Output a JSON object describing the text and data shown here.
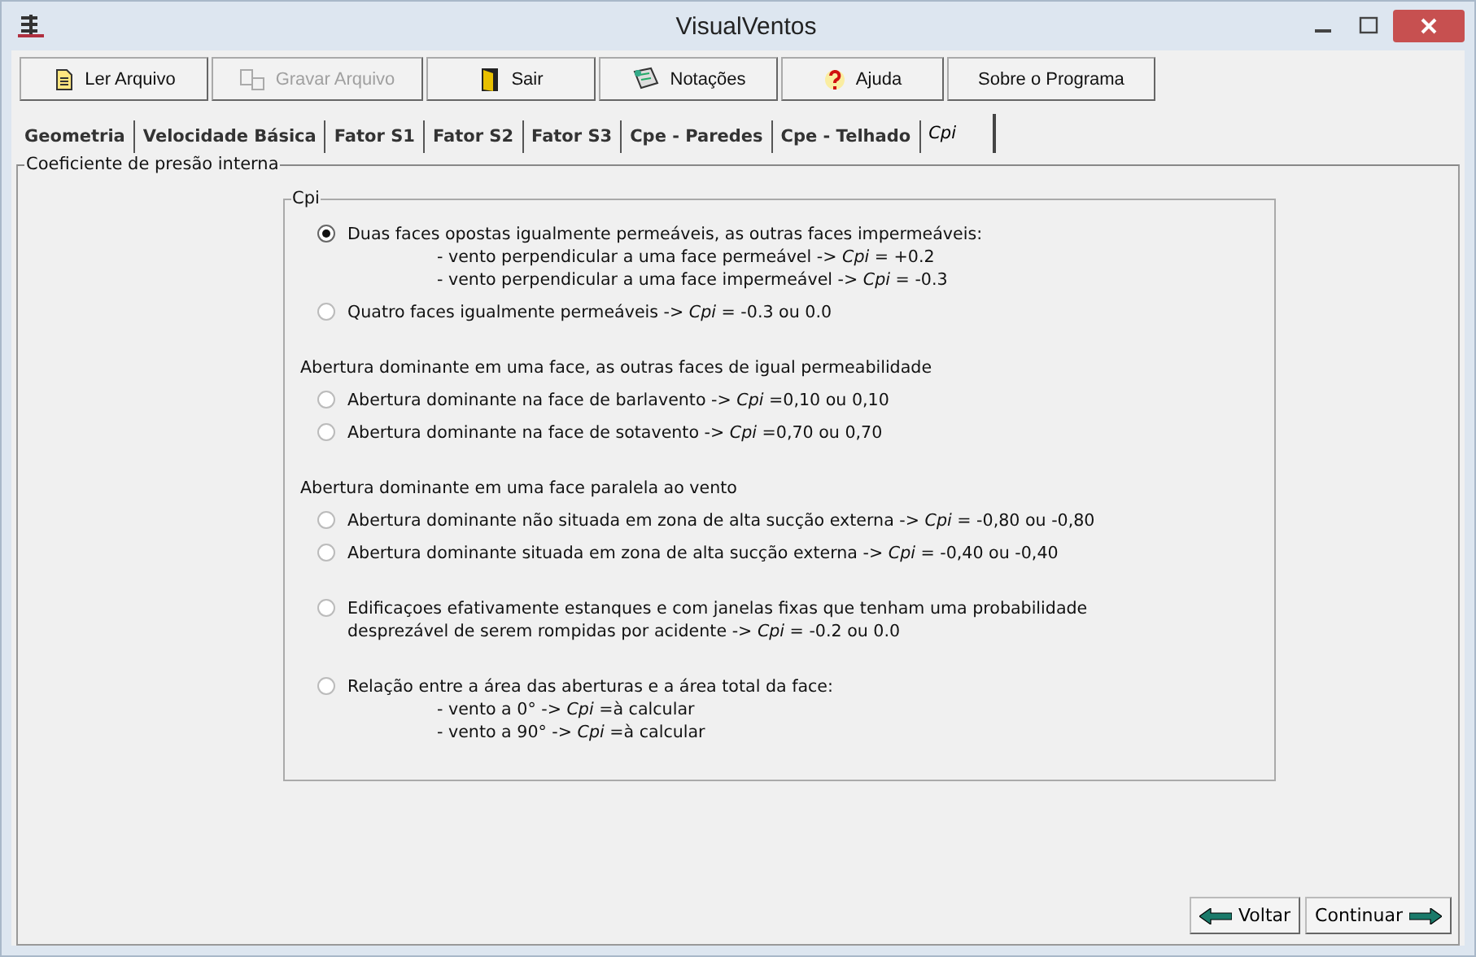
{
  "window": {
    "title": "VisualVentos"
  },
  "toolbar": [
    {
      "label": "Ler Arquivo",
      "kind": "open",
      "disabled": false
    },
    {
      "label": "Gravar Arquivo",
      "kind": "save",
      "disabled": true
    },
    {
      "label": "Sair",
      "kind": "exit",
      "disabled": false
    },
    {
      "label": "Notações",
      "kind": "notes",
      "disabled": false
    },
    {
      "label": "Ajuda",
      "kind": "help",
      "disabled": false
    },
    {
      "label": "Sobre o Programa",
      "kind": "about",
      "disabled": false
    }
  ],
  "tabs": [
    {
      "label": "Geometria",
      "selected": false
    },
    {
      "label": "Velocidade Básica",
      "selected": false
    },
    {
      "label": "Fator S1",
      "selected": false
    },
    {
      "label": "Fator S2",
      "selected": false
    },
    {
      "label": "Fator S3",
      "selected": false
    },
    {
      "label": "Cpe - Paredes",
      "selected": false
    },
    {
      "label": "Cpe - Telhado",
      "selected": false
    },
    {
      "label": "Cpi",
      "selected": true
    }
  ],
  "panel": {
    "title": "Coeficiente de presão interna",
    "group_title": "Cpi",
    "groups": [
      {
        "options": [
          {
            "selected": true,
            "lines": [
              "Duas faces opostas igualmente permeáveis, as outras faces impermeáveis:"
            ],
            "sub": [
              "- vento perpendicular a uma face permeável -> *Cpi* = +0.2",
              "- vento perpendicular a uma face impermeável -> *Cpi* = -0.3"
            ]
          },
          {
            "selected": false,
            "lines": [
              "Quatro faces igualmente permeáveis -> *Cpi* = -0.3 ou 0.0"
            ]
          }
        ]
      },
      {
        "heading": "Abertura dominante em uma face, as outras faces de igual permeabilidade",
        "options": [
          {
            "selected": false,
            "lines": [
              "Abertura dominante na face de barlavento -> *Cpi* =0,10   ou 0,10"
            ]
          },
          {
            "selected": false,
            "lines": [
              "Abertura dominante na face de sotavento -> *Cpi* =0,70  ou 0,70"
            ]
          }
        ]
      },
      {
        "heading": "Abertura dominante em uma face paralela ao vento",
        "options": [
          {
            "selected": false,
            "lines": [
              "Abertura dominante não situada em zona de alta sucção externa -> *Cpi* = -0,80 ou -0,80"
            ]
          },
          {
            "selected": false,
            "lines": [
              "Abertura dominante situada em zona de alta sucção externa -> *Cpi* = -0,40 ou -0,40"
            ]
          }
        ]
      },
      {
        "options": [
          {
            "selected": false,
            "lines": [
              "Edificaçoes efativamente estanques e com janelas fixas que tenham uma probabilidade",
              "desprezável de serem rompidas por acidente -> *Cpi* = -0.2 ou 0.0"
            ]
          }
        ]
      },
      {
        "options": [
          {
            "selected": false,
            "lines": [
              "Relação entre a área das aberturas e a área total da face:"
            ],
            "sub": [
              "- vento a 0° -> *Cpi* =à calcular",
              "- vento a 90° -> *Cpi* =à calcular"
            ]
          }
        ]
      }
    ]
  },
  "nav": [
    {
      "label": "Voltar",
      "kind": "back"
    },
    {
      "label": "Continuar",
      "kind": "next"
    }
  ]
}
